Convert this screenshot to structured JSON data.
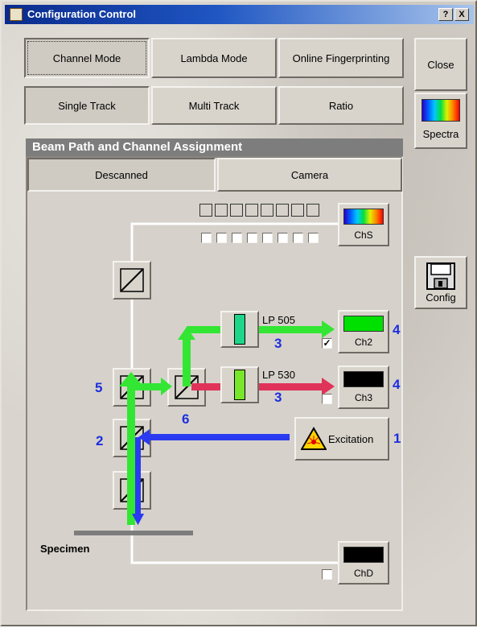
{
  "window": {
    "title": "Configuration Control",
    "help_label": "?",
    "close_label": "X"
  },
  "mode_tabs": [
    {
      "label": "Channel Mode",
      "selected": true
    },
    {
      "label": "Lambda Mode",
      "selected": false
    },
    {
      "label": "Online Fingerprinting",
      "selected": false
    }
  ],
  "track_tabs": [
    {
      "label": "Single Track",
      "selected": true
    },
    {
      "label": "Multi Track",
      "selected": false
    },
    {
      "label": "Ratio",
      "selected": false
    }
  ],
  "side_buttons": {
    "close": "Close",
    "spectra": "Spectra",
    "config": "Config"
  },
  "panel": {
    "title": "Beam Path and Channel Assignment",
    "tabs": [
      {
        "label": "Descanned",
        "selected": true
      },
      {
        "label": "Camera",
        "selected": false
      }
    ]
  },
  "channels": {
    "chs": {
      "label": "ChS"
    },
    "ch2": {
      "label": "Ch2",
      "color": "#00e000",
      "checked": true
    },
    "ch3": {
      "label": "Ch3",
      "color": "#000000",
      "checked": false
    },
    "chd": {
      "label": "ChD",
      "color": "#000000",
      "checked": false
    }
  },
  "filters": {
    "f1": "LP 505",
    "f2": "LP 530"
  },
  "excitation": {
    "label": "Excitation"
  },
  "specimen": {
    "label": "Specimen"
  },
  "numbers": {
    "n1": "1",
    "n2": "2",
    "n3a": "3",
    "n3b": "3",
    "n4a": "4",
    "n4b": "4",
    "n5": "5",
    "n6": "6"
  },
  "colors": {
    "emission": "#33e633",
    "excitation": "#2a3af0",
    "red_emission": "#e0335a",
    "callout": "#1d2ee0"
  }
}
